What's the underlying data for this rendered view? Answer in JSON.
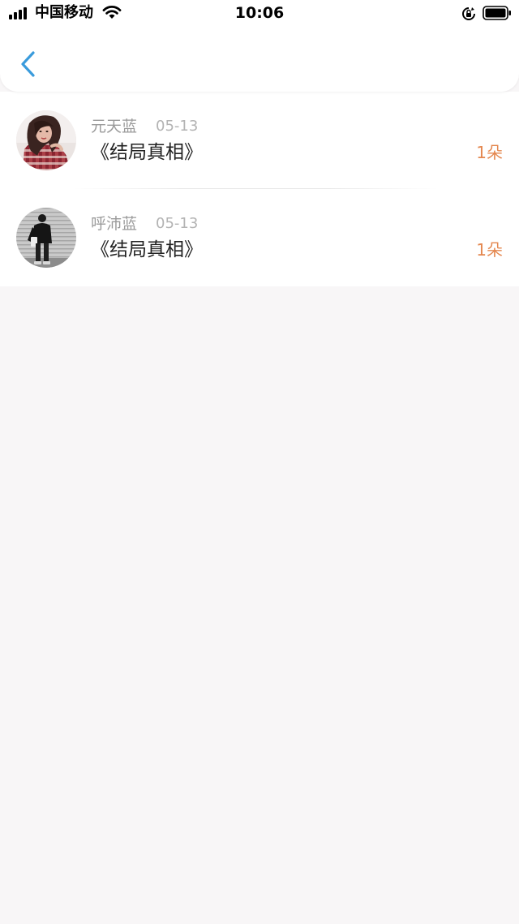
{
  "status_bar": {
    "carrier": "中国移动",
    "time": "10:06"
  },
  "header": {
    "back_icon": "chevron-left-icon",
    "accent_color": "#3a9bdc"
  },
  "records": [
    {
      "name": "元天蓝",
      "date": "05-13",
      "title": "《结局真相》",
      "count": "1朵"
    },
    {
      "name": "呼沛蓝",
      "date": "05-13",
      "title": "《结局真相》",
      "count": "1朵"
    }
  ],
  "colors": {
    "count": "#e4874f",
    "background": "#f8f6f7"
  }
}
